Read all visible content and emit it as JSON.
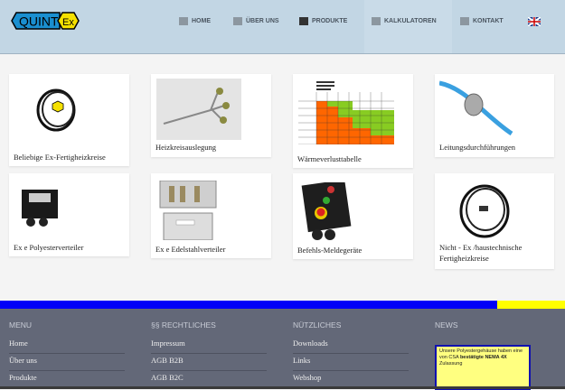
{
  "header": {
    "logo_text": "QUINT",
    "logo_badge": "Ex",
    "nav": [
      {
        "label": "HOME",
        "icon": "home-icon"
      },
      {
        "label": "ÜBER UNS",
        "icon": "person-icon"
      },
      {
        "label": "PRODUKTE",
        "icon": "gear-icon"
      },
      {
        "label": "KALKULATOREN",
        "icon": "calculator-icon"
      },
      {
        "label": "KONTAKT",
        "icon": "envelope-icon"
      }
    ],
    "language_flag": "uk-flag-icon"
  },
  "products": [
    {
      "label": "Beliebige Ex-Fertigheizkreise"
    },
    {
      "label": "Heizkreisauslegung"
    },
    {
      "label": "Wärmeverlusttabelle"
    },
    {
      "label": "Leitungsdurchführungen"
    },
    {
      "label": "Ex e Polyesterverteiler"
    },
    {
      "label": "Ex e Edelstahlverteiler"
    },
    {
      "label": "Befehls-Meldegeräte"
    },
    {
      "label": "Nicht - Ex /haustechnische Fertigheizkreise"
    }
  ],
  "colors": {
    "stripe_blue": "#0000f8",
    "stripe_yellow": "#ffff00",
    "footer_bg": "#636878",
    "header_bg": "#c2d6e4"
  },
  "footer": {
    "menu": {
      "title": "MENU",
      "links": [
        "Home",
        "Über uns",
        "Produkte"
      ]
    },
    "legal": {
      "title": "§§ RECHTLICHES",
      "links": [
        "Impressum",
        "AGB B2B",
        "AGB B2C"
      ]
    },
    "useful": {
      "title": "NÜTZLICHES",
      "links": [
        "Downloads",
        "Links",
        "Webshop"
      ]
    },
    "news": {
      "title": "NEWS",
      "text_start": "Unsere Polyestergehäuse haben eine von CSA ",
      "text_bold": "bestätigte NEMA 4X",
      "text_end": " Zulassung"
    }
  }
}
